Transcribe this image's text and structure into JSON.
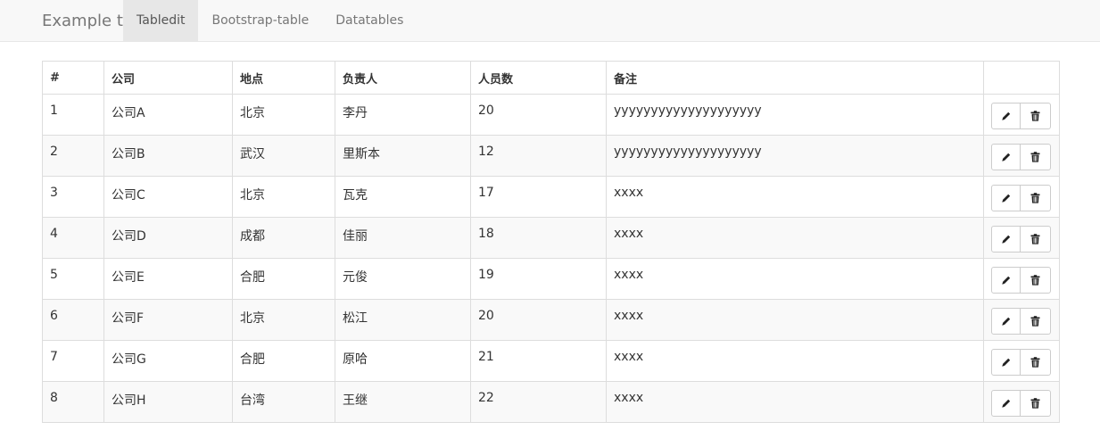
{
  "navbar": {
    "brand": "Example table",
    "tabs": [
      {
        "label": "Tabledit",
        "active": true
      },
      {
        "label": "Bootstrap-table",
        "active": false
      },
      {
        "label": "Datatables",
        "active": false
      }
    ]
  },
  "table": {
    "headers": [
      "#",
      "公司",
      "地点",
      "负责人",
      "人员数",
      "备注",
      ""
    ],
    "rows": [
      [
        "1",
        "公司A",
        "北京",
        "李丹",
        "20",
        "yyyyyyyyyyyyyyyyyyyy"
      ],
      [
        "2",
        "公司B",
        "武汉",
        "里斯本",
        "12",
        "yyyyyyyyyyyyyyyyyyyy"
      ],
      [
        "3",
        "公司C",
        "北京",
        "瓦克",
        "17",
        "xxxx"
      ],
      [
        "4",
        "公司D",
        "成都",
        "佳丽",
        "18",
        "xxxx"
      ],
      [
        "5",
        "公司E",
        "合肥",
        "元俊",
        "19",
        "xxxx"
      ],
      [
        "6",
        "公司F",
        "北京",
        "松江",
        "20",
        "xxxx"
      ],
      [
        "7",
        "公司G",
        "合肥",
        "原哈",
        "21",
        "xxxx"
      ],
      [
        "8",
        "公司H",
        "台湾",
        "王继",
        "22",
        "xxxx"
      ]
    ],
    "actions": {
      "edit_icon": "pencil-icon",
      "delete_icon": "trash-icon"
    }
  },
  "colors": {
    "navbar_bg": "#f8f8f8",
    "active_tab_bg": "#e7e7e7",
    "border": "#dddddd",
    "stripe": "#f9f9f9"
  }
}
